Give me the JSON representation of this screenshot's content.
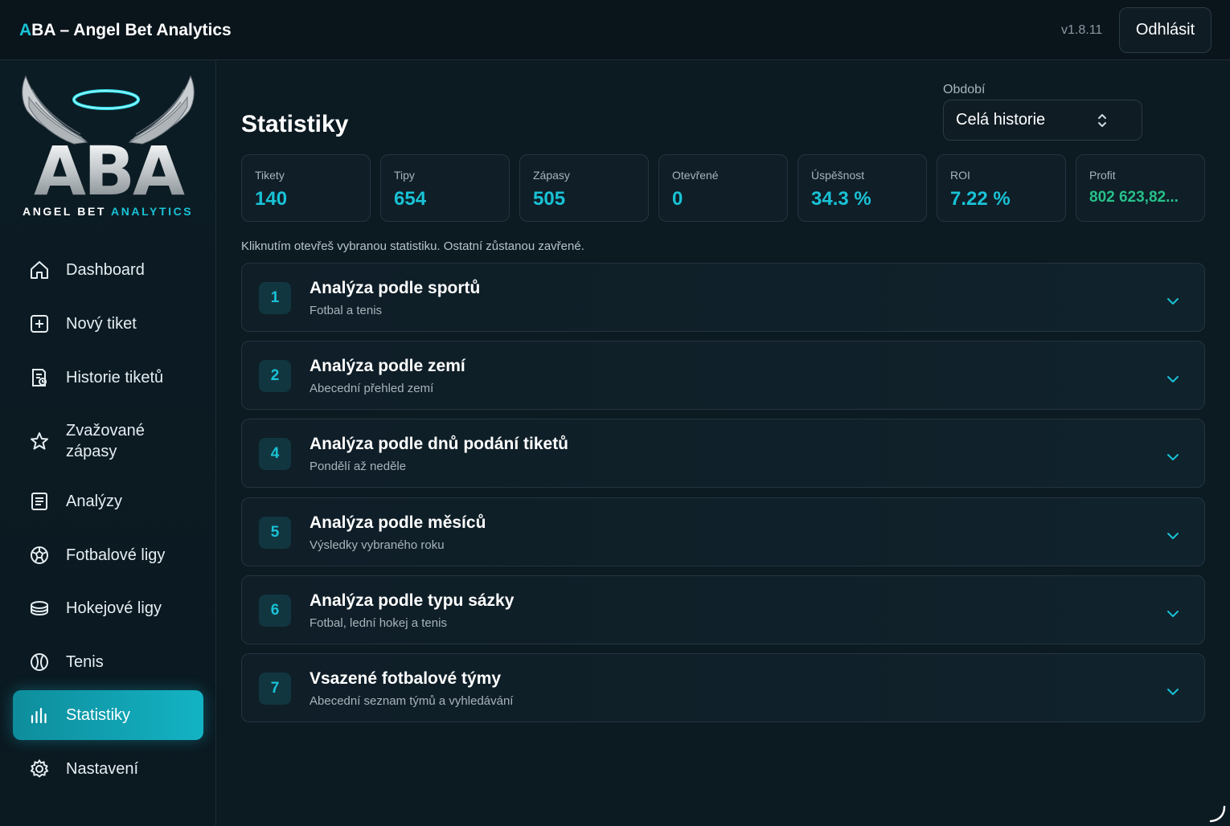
{
  "header": {
    "title_accent": "A",
    "title_rest": "BA – Angel Bet Analytics",
    "version": "v1.8.11",
    "logout_label": "Odhlásit"
  },
  "logo": {
    "letters": "ABA",
    "subtitle_white": "ANGEL BET ",
    "subtitle_cyan": "ANALYTICS"
  },
  "sidebar": {
    "items": [
      {
        "label": "Dashboard",
        "icon": "home-icon"
      },
      {
        "label": "Nový tiket",
        "icon": "plus-square-icon"
      },
      {
        "label": "Historie tiketů",
        "icon": "ticket-history-icon"
      },
      {
        "label": "Zvažované zápasy",
        "icon": "star-icon"
      },
      {
        "label": "Analýzy",
        "icon": "document-icon"
      },
      {
        "label": "Fotbalové ligy",
        "icon": "football-icon"
      },
      {
        "label": "Hokejové ligy",
        "icon": "hockey-puck-icon"
      },
      {
        "label": "Tenis",
        "icon": "tennis-ball-icon"
      },
      {
        "label": "Statistiky",
        "icon": "bar-chart-icon",
        "active": true
      },
      {
        "label": "Nastavení",
        "icon": "gear-icon"
      }
    ]
  },
  "main": {
    "title": "Statistiky",
    "period": {
      "label": "Období",
      "value": "Celá historie"
    },
    "stats": [
      {
        "label": "Tikety",
        "value": "140"
      },
      {
        "label": "Tipy",
        "value": "654"
      },
      {
        "label": "Zápasy",
        "value": "505"
      },
      {
        "label": "Otevřené",
        "value": "0"
      },
      {
        "label": "Úspěšnost",
        "value": "34.3 %"
      },
      {
        "label": "ROI",
        "value": "7.22 %"
      },
      {
        "label": "Profit",
        "value": "802 623,82..."
      }
    ],
    "hint": "Kliknutím otevřeš vybranou statistiku. Ostatní zůstanou zavřené.",
    "sections": [
      {
        "num": "1",
        "title": "Analýza podle sportů",
        "subtitle": "Fotbal a tenis"
      },
      {
        "num": "2",
        "title": "Analýza podle zemí",
        "subtitle": "Abecední přehled zemí"
      },
      {
        "num": "4",
        "title": "Analýza podle dnů podání tiketů",
        "subtitle": "Pondělí až neděle"
      },
      {
        "num": "5",
        "title": "Analýza podle měsíců",
        "subtitle": "Výsledky vybraného roku"
      },
      {
        "num": "6",
        "title": "Analýza podle typu sázky",
        "subtitle": "Fotbal, lední hokej a tenis"
      },
      {
        "num": "7",
        "title": "Vsazené fotbalové týmy",
        "subtitle": "Abecední seznam týmů a vyhledávání"
      }
    ]
  },
  "colors": {
    "accent": "#19c2d6",
    "profit": "#27c08a",
    "background": "#0c1a22"
  }
}
